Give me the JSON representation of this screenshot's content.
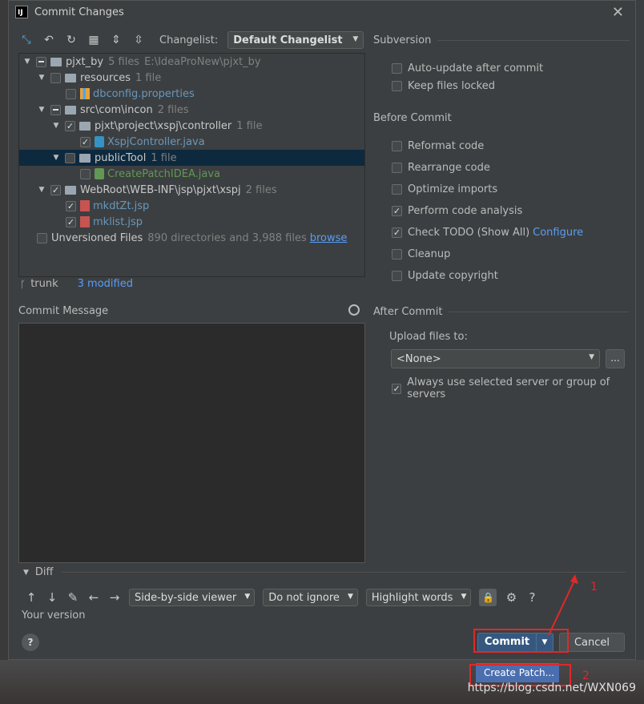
{
  "window": {
    "title": "Commit Changes",
    "logo": "IJ"
  },
  "toolbar": {
    "changelist_label": "Changelist:",
    "changelist_value": "Default Changelist"
  },
  "tree": {
    "rows": [
      {
        "name": "pjxt_by",
        "count": "5 files",
        "path": "E:\\IdeaProNew\\pjxt_by"
      },
      {
        "name": "resources",
        "count": "1 file"
      },
      {
        "name": "dbconfig.properties"
      },
      {
        "name": "src\\com\\incon",
        "count": "2 files"
      },
      {
        "name": "pjxt\\project\\xspj\\controller",
        "count": "1 file"
      },
      {
        "name": "XspjController.java"
      },
      {
        "name": "publicTool",
        "count": "1 file"
      },
      {
        "name": "CreatePatchIDEA.java"
      },
      {
        "name": "WebRoot\\WEB-INF\\jsp\\pjxt\\xspj",
        "count": "2 files"
      },
      {
        "name": "mkdtZt.jsp"
      },
      {
        "name": "mklist.jsp"
      }
    ],
    "unversioned": {
      "label": "Unversioned Files",
      "meta": "890 directories and 3,988 files",
      "link": "browse"
    }
  },
  "branch": {
    "name": "trunk",
    "modified": "3 modified"
  },
  "commit_message": {
    "label": "Commit Message",
    "value": ""
  },
  "subversion": {
    "header": "Subversion",
    "auto_update": "Auto-update after commit",
    "keep_locked": "Keep files locked"
  },
  "before_commit": {
    "header": "Before Commit",
    "reformat": "Reformat code",
    "rearrange": "Rearrange code",
    "optimize": "Optimize imports",
    "analysis": "Perform code analysis",
    "todo": "Check TODO (Show All)",
    "todo_link": "Configure",
    "cleanup": "Cleanup",
    "copyright": "Update copyright"
  },
  "after_commit": {
    "header": "After Commit",
    "upload_label": "Upload files to:",
    "upload_value": "<None>",
    "more": "...",
    "always_use": "Always use selected server or group of servers"
  },
  "diff": {
    "header": "Diff",
    "viewer": "Side-by-side viewer",
    "ignore": "Do not ignore",
    "highlight": "Highlight words",
    "your_version": "Your version",
    "help": "?"
  },
  "buttons": {
    "help": "?",
    "commit": "Commit",
    "cancel": "Cancel"
  },
  "popup": {
    "create_patch": "Create Patch..."
  },
  "annotations": {
    "num1": "1",
    "num2": "2",
    "color": "#e0282a"
  },
  "watermark": "https://blog.csdn.net/WXN069"
}
